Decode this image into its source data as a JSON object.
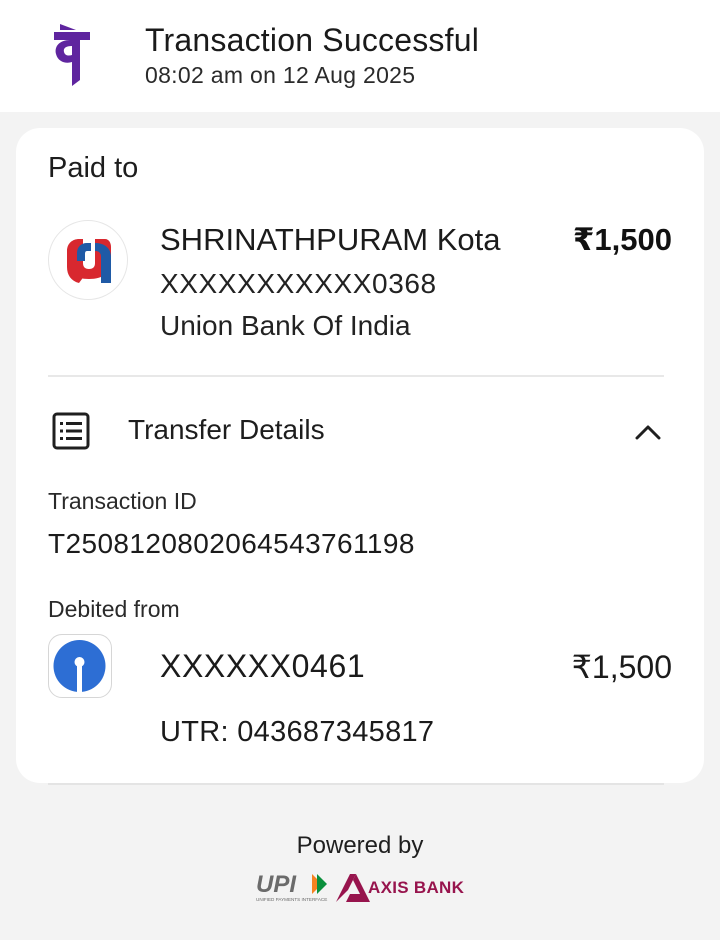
{
  "header": {
    "title": "Transaction Successful",
    "subtitle": "08:02 am on 12 Aug 2025",
    "brand_icon": "phonepe-logo-icon",
    "brand_color": "#5f259f"
  },
  "paid_to": {
    "section_label": "Paid to",
    "name": "SHRINATHPURAM Kota",
    "amount": "₹1,500",
    "account": "XXXXXXXXXXX0368",
    "bank": "Union Bank Of India",
    "bank_icon": "union-bank-logo-icon"
  },
  "transfer_details": {
    "label": "Transfer Details",
    "icon": "receipt-list-icon",
    "toggle_icon": "chevron-up-icon",
    "expanded": true,
    "transaction_id_label": "Transaction ID",
    "transaction_id": "T2508120802064543761198",
    "debited_from_label": "Debited from",
    "debit_bank_icon": "sbi-logo-icon",
    "debit_account": "XXXXXX0461",
    "debit_amount": "₹1,500",
    "utr": "UTR: 043687345817"
  },
  "footer": {
    "powered_by": "Powered by",
    "upi_logo_text": "UPI",
    "upi_tagline": "UNIFIED PAYMENTS INTERFACE",
    "axis_logo_text": "AXIS BANK",
    "axis_color": "#97144d"
  }
}
